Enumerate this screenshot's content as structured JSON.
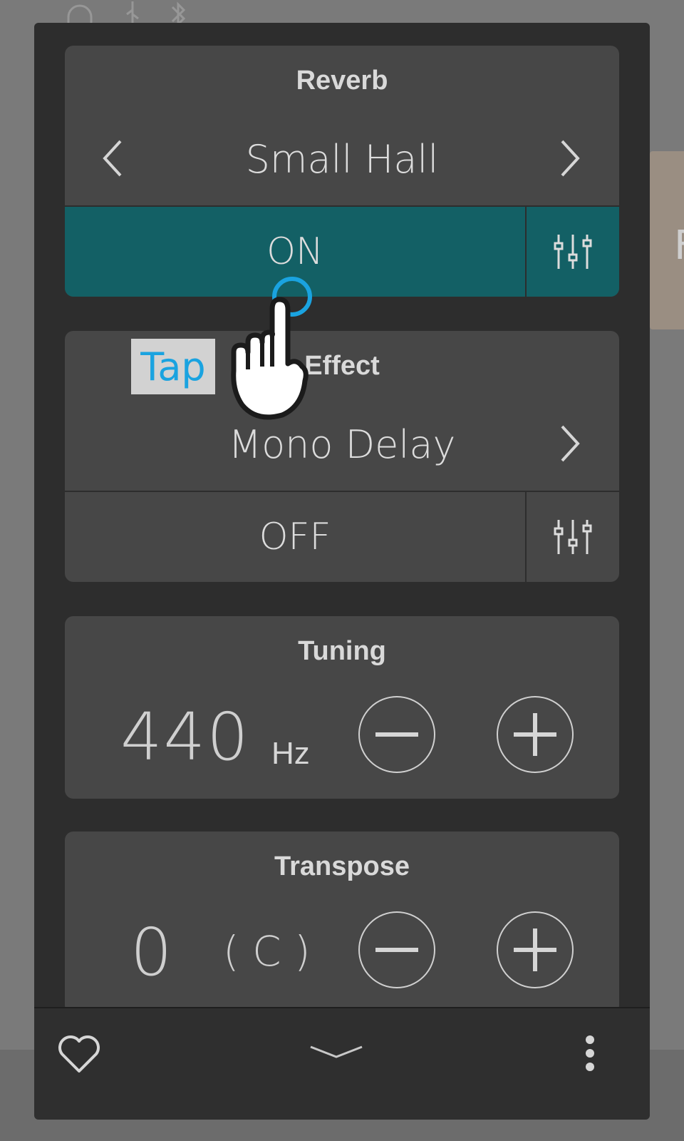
{
  "reverb": {
    "title": "Reverb",
    "value": "Small Hall",
    "state": "ON"
  },
  "effect": {
    "title": "Effect",
    "value": "Mono Delay",
    "state": "OFF"
  },
  "tuning": {
    "title": "Tuning",
    "value": "440",
    "unit": "Hz"
  },
  "transpose": {
    "title": "Transpose",
    "value": "0",
    "key": "( C )"
  },
  "overlay": {
    "tap_label": "Tap"
  },
  "background": {
    "card_letter": "F"
  },
  "colors": {
    "on_accent": "#136065",
    "tap_blue": "#1aa3e0",
    "panel": "#2d2d2d",
    "card": "#474747"
  },
  "icons": [
    "headphones-icon",
    "usb-icon",
    "bluetooth-icon",
    "chevron-left-icon",
    "chevron-right-icon",
    "sliders-icon",
    "minus-icon",
    "plus-icon",
    "heart-icon",
    "chevron-down-icon",
    "more-vertical-icon",
    "hand-pointer-icon"
  ]
}
